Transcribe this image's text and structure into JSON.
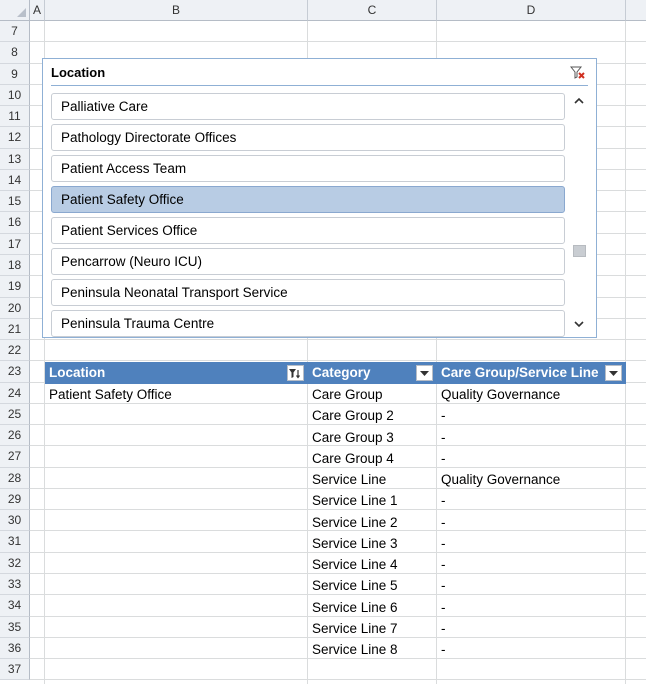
{
  "columns": [
    "A",
    "B",
    "C",
    "D"
  ],
  "rows": [
    "7",
    "8",
    "9",
    "10",
    "11",
    "12",
    "13",
    "14",
    "15",
    "16",
    "17",
    "18",
    "19",
    "20",
    "21",
    "22",
    "23",
    "24",
    "25",
    "26",
    "27",
    "28",
    "29",
    "30",
    "31",
    "32",
    "33",
    "34",
    "35",
    "36",
    "37"
  ],
  "slicer": {
    "title": "Location",
    "items": [
      {
        "label": "Palliative Care",
        "selected": false
      },
      {
        "label": "Pathology Directorate Offices",
        "selected": false
      },
      {
        "label": "Patient Access Team",
        "selected": false
      },
      {
        "label": "Patient Safety Office",
        "selected": true
      },
      {
        "label": "Patient Services Office",
        "selected": false
      },
      {
        "label": "Pencarrow (Neuro ICU)",
        "selected": false
      },
      {
        "label": "Peninsula Neonatal Transport Service",
        "selected": false
      },
      {
        "label": "Peninsula Trauma Centre",
        "selected": false
      }
    ],
    "clear_filter_icon": "clear-filter-icon"
  },
  "table": {
    "headers": [
      "Location",
      "Category",
      "Care Group/Service Line"
    ],
    "rows": [
      [
        "Patient Safety Office",
        "Care Group",
        "Quality Governance"
      ],
      [
        "",
        "Care Group 2",
        "-"
      ],
      [
        "",
        "Care Group 3",
        "-"
      ],
      [
        "",
        "Care Group 4",
        "-"
      ],
      [
        "",
        "Service Line",
        "Quality Governance"
      ],
      [
        "",
        "Service Line 1",
        "-"
      ],
      [
        "",
        "Service Line 2",
        "-"
      ],
      [
        "",
        "Service Line 3",
        "-"
      ],
      [
        "",
        "Service Line 4",
        "-"
      ],
      [
        "",
        "Service Line 5",
        "-"
      ],
      [
        "",
        "Service Line 6",
        "-"
      ],
      [
        "",
        "Service Line 7",
        "-"
      ],
      [
        "",
        "Service Line 8",
        "-"
      ]
    ]
  },
  "colors": {
    "header_blue": "#4f81bd",
    "selected_item": "#b8cce4",
    "slicer_border": "#8fb0d5"
  }
}
